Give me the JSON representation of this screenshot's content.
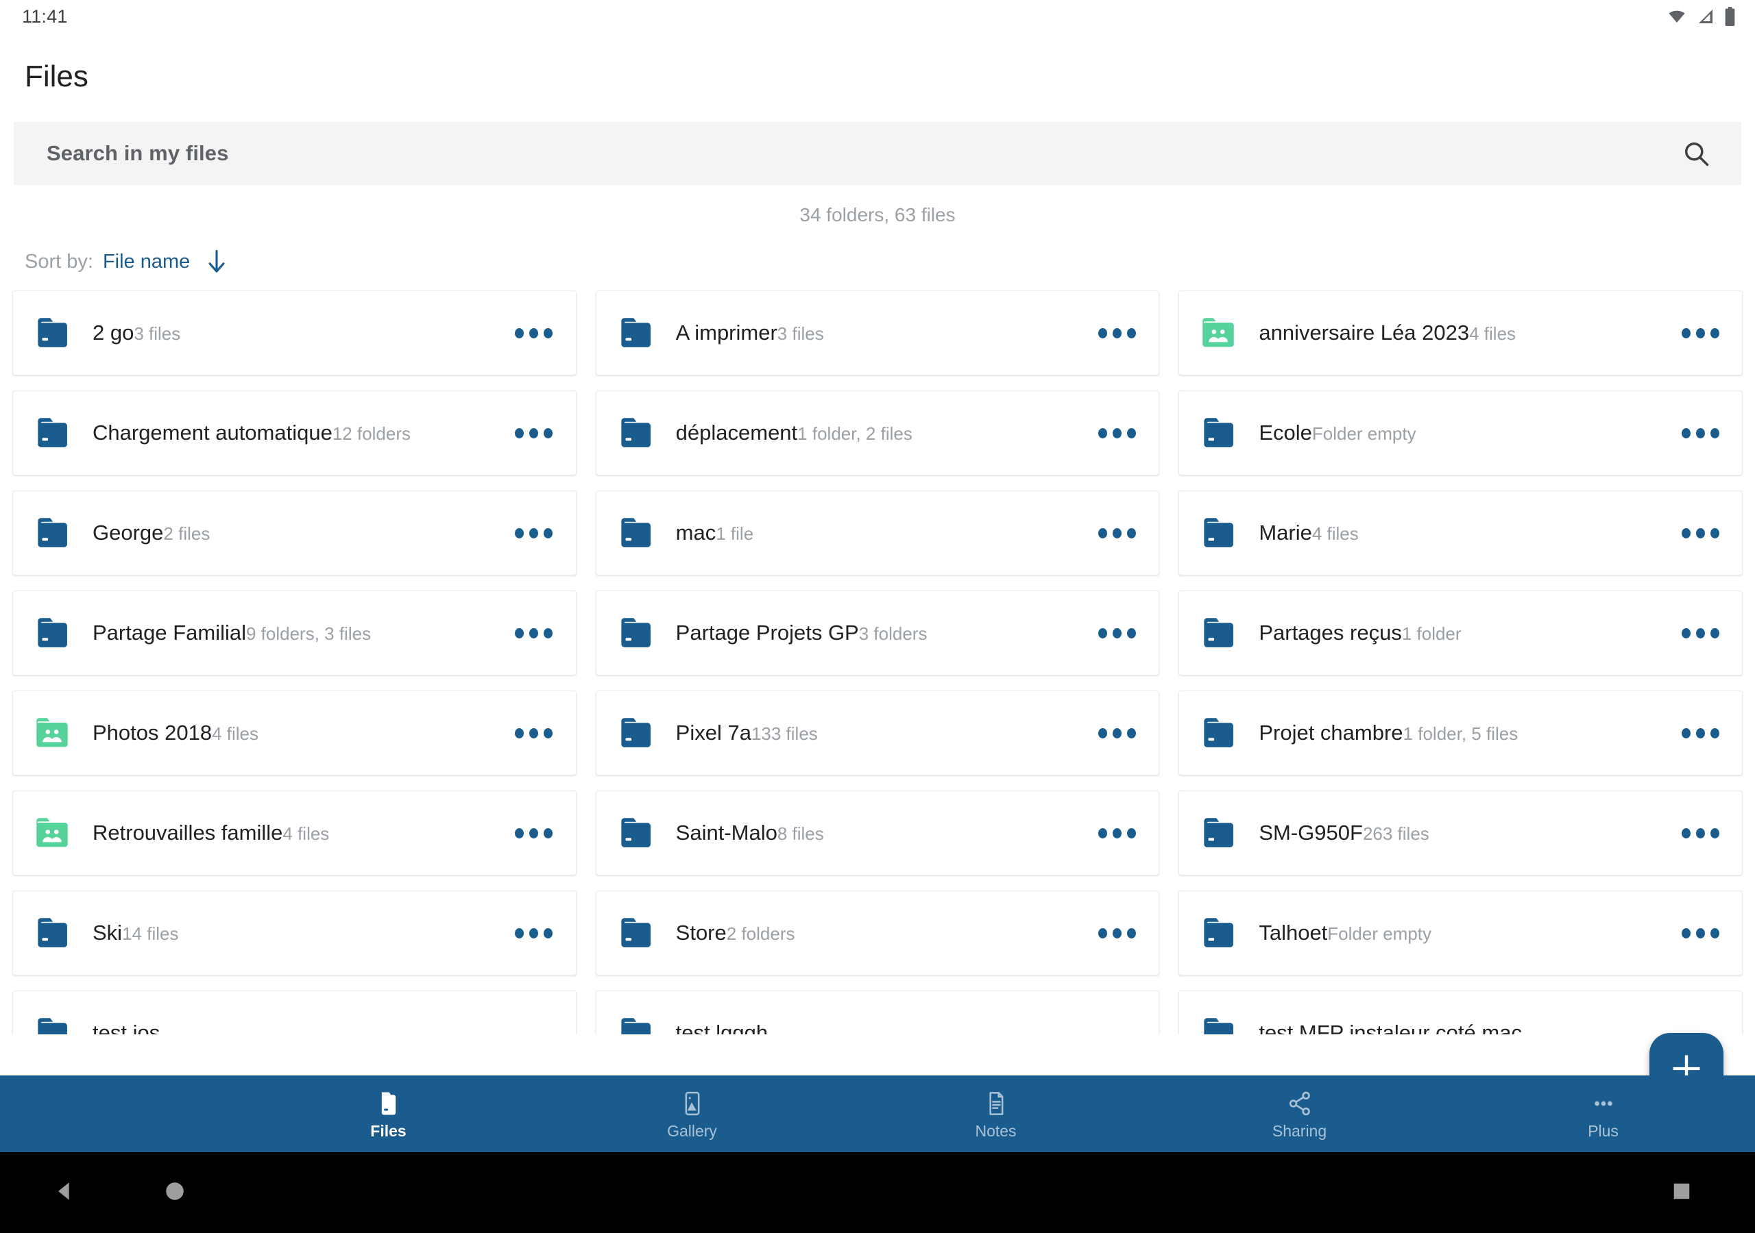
{
  "statusbar": {
    "clock": "11:41",
    "icons": [
      "wifi-icon",
      "signal-icon",
      "battery-icon"
    ]
  },
  "header": {
    "title": "Files"
  },
  "search": {
    "placeholder": "Search in my files",
    "icon": "search-icon"
  },
  "summary": {
    "counts": "34 folders, 63 files"
  },
  "sort": {
    "label": "Sort by:",
    "value": "File name",
    "direction_icon": "arrow-down-icon"
  },
  "colors": {
    "accent": "#1b5c8e",
    "folder_blue": "#1b5c8e",
    "folder_green": "#55d39a",
    "search_bg": "#f4f4f4",
    "muted_text": "#9aa0a6",
    "primary_text": "#202124"
  },
  "items": [
    {
      "name": "2 go",
      "sub": "3 files",
      "kind": "folder"
    },
    {
      "name": "A imprimer",
      "sub": "3 files",
      "kind": "folder"
    },
    {
      "name": "anniversaire Léa 2023",
      "sub": "4 files",
      "kind": "shared"
    },
    {
      "name": "Chargement automatique",
      "sub": "12 folders",
      "kind": "folder"
    },
    {
      "name": "déplacement",
      "sub": "1 folder, 2 files",
      "kind": "folder"
    },
    {
      "name": "Ecole",
      "sub": "Folder empty",
      "kind": "folder"
    },
    {
      "name": "George",
      "sub": "2 files",
      "kind": "folder"
    },
    {
      "name": "mac",
      "sub": "1 file",
      "kind": "folder"
    },
    {
      "name": "Marie",
      "sub": "4 files",
      "kind": "folder"
    },
    {
      "name": "Partage Familial",
      "sub": "9 folders, 3 files",
      "kind": "folder"
    },
    {
      "name": "Partage Projets GP",
      "sub": "3 folders",
      "kind": "folder"
    },
    {
      "name": "Partages reçus",
      "sub": "1 folder",
      "kind": "folder"
    },
    {
      "name": "Photos 2018",
      "sub": "4 files",
      "kind": "shared"
    },
    {
      "name": "Pixel 7a",
      "sub": "133 files",
      "kind": "folder"
    },
    {
      "name": "Projet chambre",
      "sub": "1 folder, 5 files",
      "kind": "folder"
    },
    {
      "name": "Retrouvailles famille",
      "sub": "4 files",
      "kind": "shared"
    },
    {
      "name": "Saint-Malo",
      "sub": "8 files",
      "kind": "folder"
    },
    {
      "name": "SM-G950F",
      "sub": "263 files",
      "kind": "folder"
    },
    {
      "name": "Ski",
      "sub": "14 files",
      "kind": "folder"
    },
    {
      "name": "Store",
      "sub": "2 folders",
      "kind": "folder"
    },
    {
      "name": "Talhoet",
      "sub": "Folder empty",
      "kind": "folder"
    }
  ],
  "items_partial": [
    {
      "name": "test ios",
      "sub": "",
      "kind": "folder"
    },
    {
      "name": "test lgggh",
      "sub": "",
      "kind": "folder"
    },
    {
      "name": "test MFP instaleur coté mac",
      "sub": "",
      "kind": "folder"
    }
  ],
  "fab": {
    "label": "+",
    "icon": "plus-icon"
  },
  "bottom_nav": {
    "items": [
      {
        "label": "Files",
        "icon": "files-icon",
        "active": true
      },
      {
        "label": "Gallery",
        "icon": "gallery-icon",
        "active": false
      },
      {
        "label": "Notes",
        "icon": "notes-icon",
        "active": false
      },
      {
        "label": "Sharing",
        "icon": "share-icon",
        "active": false
      },
      {
        "label": "Plus",
        "icon": "more-icon",
        "active": false
      }
    ]
  },
  "android_nav": {
    "back": "back-triangle-icon",
    "home": "home-circle-icon",
    "recents": "recents-square-icon"
  },
  "menu_icon_name": "overflow-menu-icon"
}
